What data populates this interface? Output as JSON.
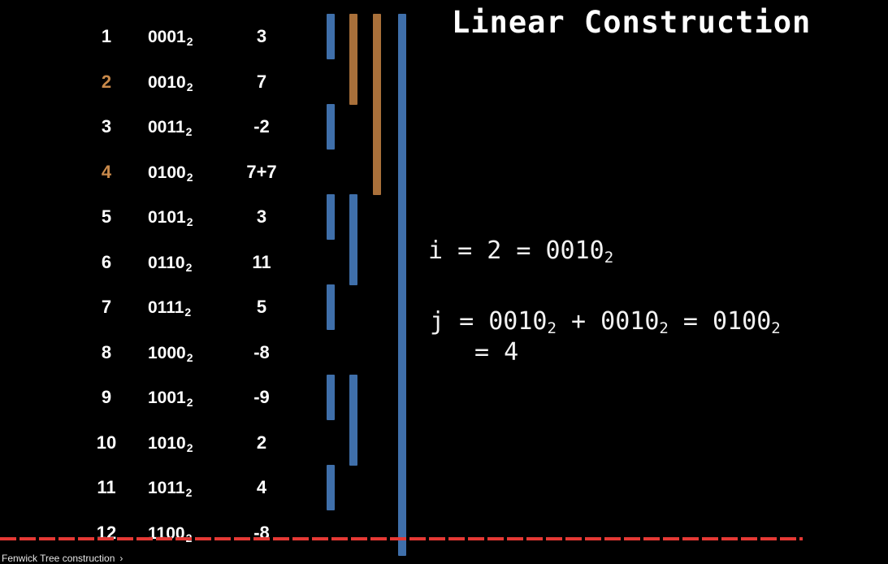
{
  "title": "Linear Construction",
  "colors": {
    "default_index": "#ffffff",
    "highlight_index": "#c8894a",
    "bar_blue": "#3f6faa",
    "bar_orange": "#a9703a",
    "progress": "#e53935"
  },
  "rows": [
    {
      "index": "12",
      "binary": "1100",
      "base": "2",
      "value": "-8",
      "highlight": false,
      "bar_level": 3,
      "bar_color": "blue"
    },
    {
      "index": "11",
      "binary": "1011",
      "base": "2",
      "value": "4",
      "highlight": false,
      "bar_level": 0,
      "bar_color": "blue"
    },
    {
      "index": "10",
      "binary": "1010",
      "base": "2",
      "value": "2",
      "highlight": false,
      "bar_level": 1,
      "bar_color": "blue"
    },
    {
      "index": "9",
      "binary": "1001",
      "base": "2",
      "value": "-9",
      "highlight": false,
      "bar_level": 0,
      "bar_color": "blue"
    },
    {
      "index": "8",
      "binary": "1000",
      "base": "2",
      "value": "-8",
      "highlight": false,
      "bar_level": 3,
      "bar_color": "blue"
    },
    {
      "index": "7",
      "binary": "0111",
      "base": "2",
      "value": "5",
      "highlight": false,
      "bar_level": 0,
      "bar_color": "blue"
    },
    {
      "index": "6",
      "binary": "0110",
      "base": "2",
      "value": "11",
      "highlight": false,
      "bar_level": 1,
      "bar_color": "blue"
    },
    {
      "index": "5",
      "binary": "0101",
      "base": "2",
      "value": "3",
      "highlight": false,
      "bar_level": 0,
      "bar_color": "blue"
    },
    {
      "index": "4",
      "binary": "0100",
      "base": "2",
      "value": "7+7",
      "highlight": true,
      "bar_level": 2,
      "bar_color": "orange"
    },
    {
      "index": "3",
      "binary": "0011",
      "base": "2",
      "value": "-2",
      "highlight": false,
      "bar_level": 0,
      "bar_color": "blue"
    },
    {
      "index": "2",
      "binary": "0010",
      "base": "2",
      "value": "7",
      "highlight": true,
      "bar_level": 1,
      "bar_color": "orange"
    },
    {
      "index": "1",
      "binary": "0001",
      "base": "2",
      "value": "3",
      "highlight": false,
      "bar_level": 0,
      "bar_color": "blue"
    }
  ],
  "equations": {
    "i_line": {
      "lhs": "i = 2 = 0010",
      "sub": "2"
    },
    "j_line": {
      "t1": "j = 0010",
      "s1": "2",
      "t2": " + 0010",
      "s2": "2",
      "t3": " = 0100",
      "s3": "2"
    },
    "j_result": "= 4"
  },
  "video": {
    "chapter_title": "Fenwick Tree construction",
    "chapter_icon": "chevron-right-icon"
  }
}
